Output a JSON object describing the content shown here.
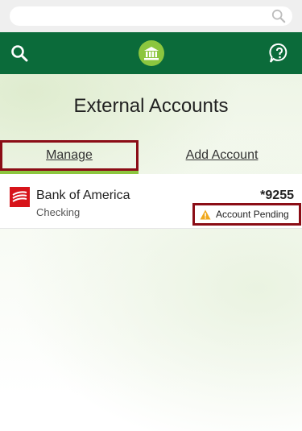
{
  "header": {
    "search_icon": "search-icon",
    "bank_icon": "bank-icon",
    "help_icon": "help-chat-icon",
    "brand_color": "#0b6b3a",
    "accent_color": "#8cc63f"
  },
  "page": {
    "title": "External Accounts"
  },
  "tabs": [
    {
      "label": "Manage",
      "active": true
    },
    {
      "label": "Add Account",
      "active": false
    }
  ],
  "accounts": [
    {
      "institution": "Bank of America",
      "type": "Checking",
      "number": "*9255",
      "status": "Account Pending",
      "status_icon": "warning-icon",
      "highlight_color": "#8b0d16"
    }
  ]
}
